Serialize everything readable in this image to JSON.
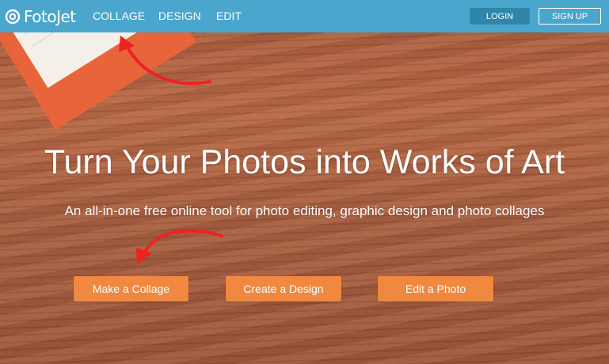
{
  "header": {
    "brand": "FotoJet",
    "nav": [
      "COLLAGE",
      "DESIGN",
      "EDIT"
    ],
    "login_label": "LOGIN",
    "signup_label": "SIGN UP"
  },
  "hero": {
    "title": "Turn Your Photos into Works of Art",
    "subtitle": "An all-in-one free online tool for photo editing, graphic design and photo collages"
  },
  "actions": [
    "Make a Collage",
    "Create a Design",
    "Edit a Photo"
  ],
  "colors": {
    "navbar": "#4aa6cc",
    "login_button": "#2f86ab",
    "cta_button": "#f0883f",
    "annotation_arrow": "#ee2222"
  }
}
